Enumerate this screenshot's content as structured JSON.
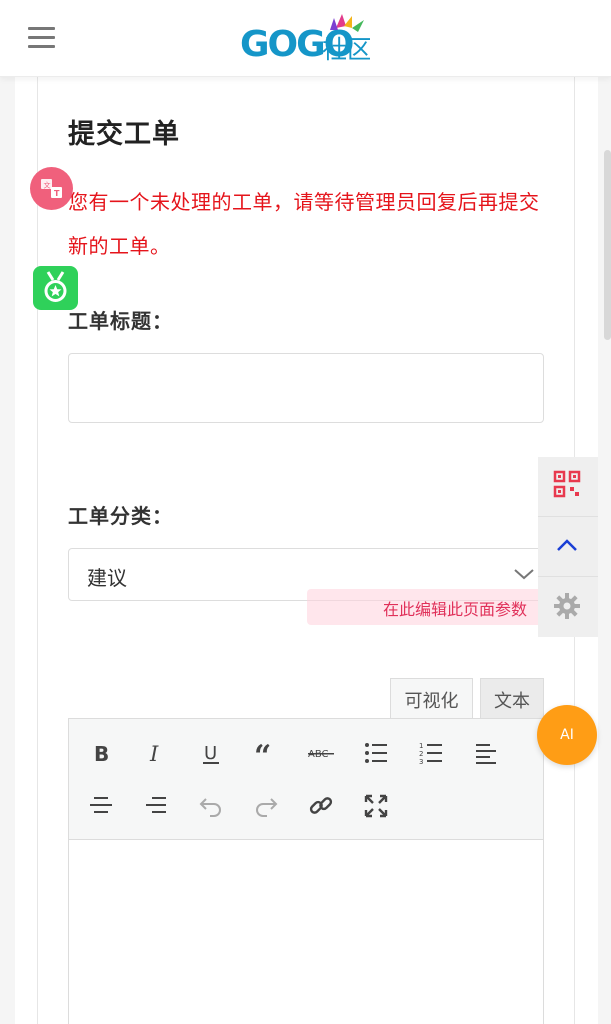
{
  "header": {
    "logo_text": "GOGO社区"
  },
  "page": {
    "title": "提交工单",
    "notice": "您有一个未处理的工单，请等待管理员回复后再提交新的工单。"
  },
  "form": {
    "title_label": "工单标题：",
    "title_value": "",
    "category_label": "工单分类：",
    "category_value": "建议"
  },
  "editor": {
    "tab_visual": "可视化",
    "tab_text": "文本",
    "toolbar": [
      "bold-icon",
      "italic-icon",
      "underline-icon",
      "blockquote-icon",
      "strikethrough-icon",
      "bullet-list-icon",
      "numbered-list-icon",
      "align-left-icon",
      "align-center-icon",
      "align-right-icon",
      "undo-icon",
      "redo-icon",
      "link-icon",
      "fullscreen-icon"
    ]
  },
  "side": {
    "param_hint": "在此编辑此页面参数",
    "ai_label": "AI"
  },
  "colors": {
    "notice": "#e5141b",
    "ai_button": "#ff9d15",
    "side_up_arrow": "#1a3fd6",
    "qr_icon": "#e8394e"
  }
}
